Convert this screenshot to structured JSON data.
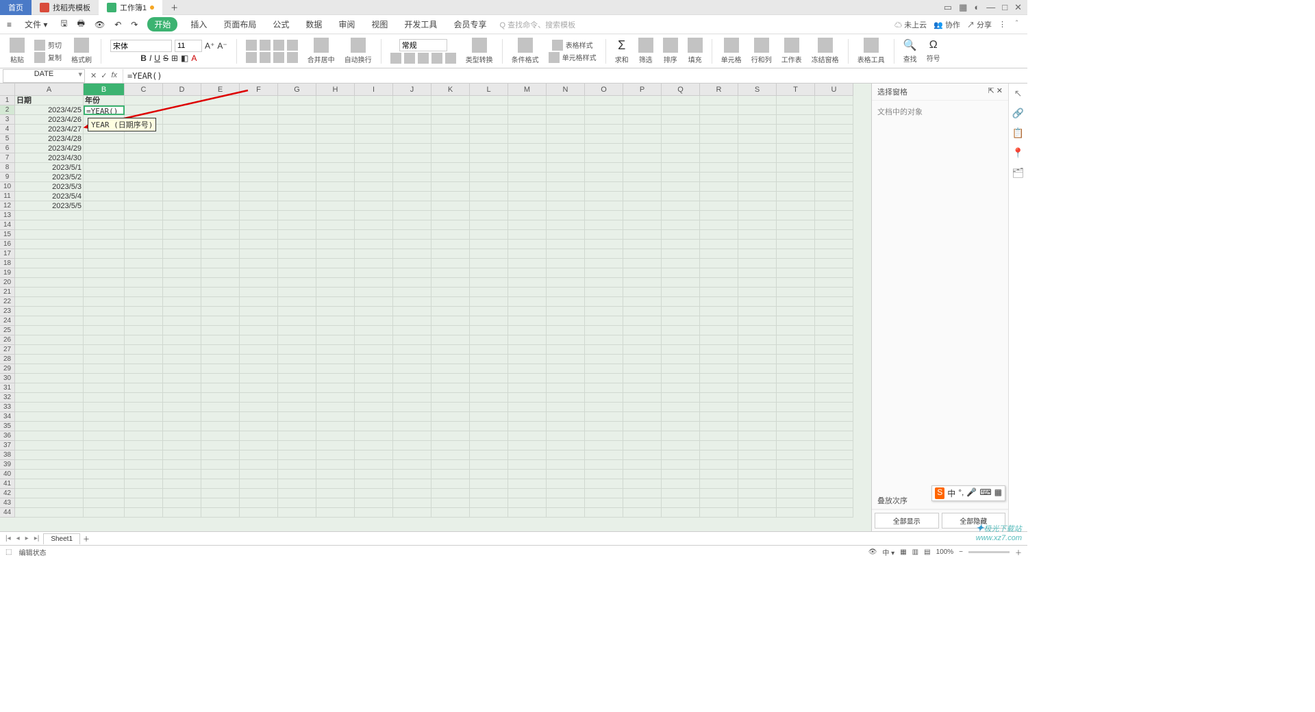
{
  "titlebar": {
    "tabs": [
      {
        "label": "首页",
        "type": "home"
      },
      {
        "label": "找稻壳模板",
        "icon": "#d94b3a"
      },
      {
        "label": "工作簿1",
        "icon": "#3cb371",
        "unsaved": true
      }
    ]
  },
  "menubar": {
    "file": "文件",
    "items": [
      "开始",
      "插入",
      "页面布局",
      "公式",
      "数据",
      "审阅",
      "视图",
      "开发工具",
      "会员专享"
    ],
    "active": "开始",
    "search_icon": "Q",
    "search_placeholder": "查找命令、搜索模板",
    "right": {
      "cloud": "未上云",
      "collab": "协作",
      "share": "分享"
    }
  },
  "ribbon": {
    "paste": "粘贴",
    "cut": "剪切",
    "copy": "复制",
    "fmtpaint": "格式刷",
    "font": "宋体",
    "size": "11",
    "merge": "合并居中",
    "wrap": "自动换行",
    "numfmt": "常规",
    "typeconv": "类型转换",
    "condfmt": "条件格式",
    "tblstyle": "表格样式",
    "cellstyle": "单元格样式",
    "sum": "求和",
    "filter": "筛选",
    "sort": "排序",
    "fill": "填充",
    "cells": "单元格",
    "rowcol": "行和列",
    "sheet": "工作表",
    "freeze": "冻结窗格",
    "tbltool": "表格工具",
    "find": "查找",
    "symbol": "符号"
  },
  "formula_bar": {
    "name": "DATE",
    "fx": "=YEAR()"
  },
  "columns": [
    "A",
    "B",
    "C",
    "D",
    "E",
    "F",
    "G",
    "H",
    "I",
    "J",
    "K",
    "L",
    "M",
    "N",
    "O",
    "P",
    "Q",
    "R",
    "S",
    "T",
    "U"
  ],
  "col_widths": {
    "default": 56,
    "A": 100,
    "B": 60
  },
  "rows": 44,
  "active_col": "B",
  "active_row": 2,
  "data": {
    "A1": "日期",
    "B1": "年份",
    "A2": "2023/4/25",
    "B2": "=YEAR()",
    "A3": "2023/4/26",
    "A4": "2023/4/27",
    "A5": "2023/4/28",
    "A6": "2023/4/29",
    "A7": "2023/4/30",
    "A8": "2023/5/1",
    "A9": "2023/5/2",
    "A10": "2023/5/3",
    "A11": "2023/5/4",
    "A12": "2023/5/5"
  },
  "tooltip": "YEAR (日期序号)",
  "sidepanel": {
    "title": "选择窗格",
    "subtitle": "文档中的对象",
    "order": "叠放次序",
    "showall": "全部显示",
    "hideall": "全部隐藏"
  },
  "sheettabs": {
    "name": "Sheet1"
  },
  "statusbar": {
    "mode": "编辑状态",
    "zoom": "100%"
  },
  "ime": {
    "brand": "S",
    "lang": "中"
  },
  "watermark": {
    "brand": "极光下载站",
    "url": "www.xz7.com"
  }
}
